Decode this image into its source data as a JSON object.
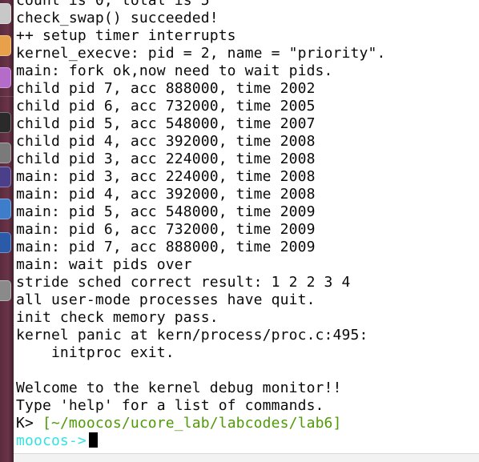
{
  "terminal": {
    "lines": [
      "count is 0, total is 5",
      "check_swap() succeeded!",
      "++ setup timer interrupts",
      "kernel_execve: pid = 2, name = \"priority\".",
      "main: fork ok,now need to wait pids.",
      "child pid 7, acc 888000, time 2002",
      "child pid 6, acc 732000, time 2005",
      "child pid 5, acc 548000, time 2007",
      "child pid 4, acc 392000, time 2008",
      "child pid 3, acc 224000, time 2008",
      "main: pid 3, acc 224000, time 2008",
      "main: pid 4, acc 392000, time 2008",
      "main: pid 5, acc 548000, time 2009",
      "main: pid 6, acc 732000, time 2009",
      "main: pid 7, acc 888000, time 2009",
      "main: wait pids over",
      "stride sched correct result: 1 2 2 3 4",
      "all user-mode processes have quit.",
      "init check memory pass.",
      "kernel panic at kern/process/proc.c:495:",
      "    initproc exit.",
      "",
      "Welcome to the kernel debug monitor!!",
      "Type 'help' for a list of commands."
    ],
    "monitor_prompt": "K> ",
    "path": "[~/moocos/ucore_lab/labcodes/lab6]",
    "shell_user": "moocos",
    "shell_arrow": "->"
  },
  "launcher": {
    "icons": [
      "files-icon",
      "firefox-icon",
      "app-icon",
      "terminal-icon",
      "settings-icon",
      "workspace-icon",
      "chrome-icon",
      "app-icon-2",
      "trash-icon"
    ],
    "colors": [
      "#c8c8c8",
      "#e8a04a",
      "#b56bc9",
      "#2a2a2a",
      "#7a7a7a",
      "#4b3f8a",
      "#3e7dc9",
      "#2a5aa8",
      "#8a8a8a"
    ]
  }
}
